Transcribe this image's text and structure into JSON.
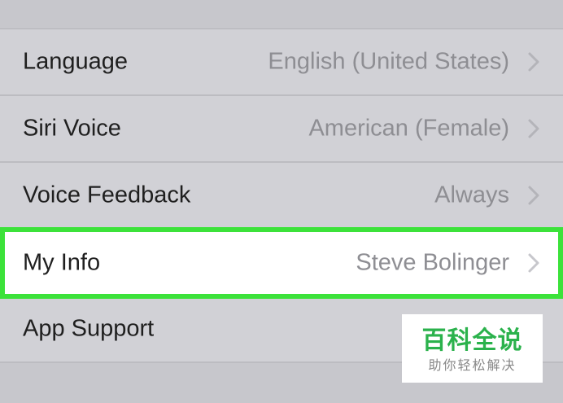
{
  "settings": {
    "rows": [
      {
        "label": "Language",
        "value": "English (United States)",
        "icon": "chevron-right-icon",
        "highlighted": false
      },
      {
        "label": "Siri Voice",
        "value": "American (Female)",
        "icon": "chevron-right-icon",
        "highlighted": false
      },
      {
        "label": "Voice Feedback",
        "value": "Always",
        "icon": "chevron-right-icon",
        "highlighted": false
      },
      {
        "label": "My Info",
        "value": "Steve Bolinger",
        "icon": "chevron-right-icon",
        "highlighted": true
      },
      {
        "label": "App Support",
        "value": "",
        "icon": "chevron-right-icon",
        "highlighted": false
      }
    ]
  },
  "watermark": {
    "title": "百科全说",
    "subtitle": "助你轻松解决"
  },
  "colors": {
    "highlight_border": "#3ce23a",
    "row_background": "#d1d1d6",
    "value_text": "#8e8e93",
    "watermark_green": "#2bb24c"
  }
}
